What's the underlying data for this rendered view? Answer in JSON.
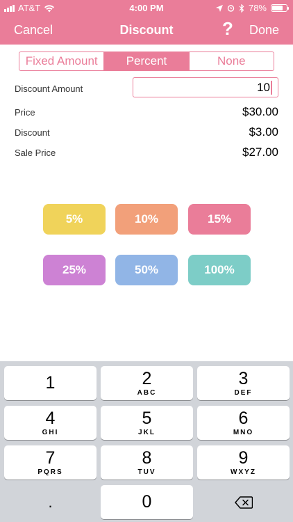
{
  "status": {
    "carrier": "AT&T",
    "time": "4:00 PM",
    "battery": "78%",
    "battery_level": 0.78
  },
  "nav": {
    "cancel_label": "Cancel",
    "title": "Discount",
    "help_label": "?",
    "done_label": "Done"
  },
  "segments": [
    {
      "label": "Fixed Amount",
      "active": false
    },
    {
      "label": "Percent",
      "active": true
    },
    {
      "label": "None",
      "active": false
    }
  ],
  "form": {
    "discount_amount_label": "Discount Amount",
    "discount_amount_value": "10",
    "price_label": "Price",
    "price_value": "$30.00",
    "discount_label": "Discount",
    "discount_value": "$3.00",
    "sale_price_label": "Sale Price",
    "sale_price_value": "$27.00"
  },
  "presets": [
    {
      "label": "5%",
      "color": "#f0d35a"
    },
    {
      "label": "10%",
      "color": "#f2a07a"
    },
    {
      "label": "15%",
      "color": "#ea7d99"
    },
    {
      "label": "25%",
      "color": "#cd82d4"
    },
    {
      "label": "50%",
      "color": "#91b5e6"
    },
    {
      "label": "100%",
      "color": "#7dcdc7"
    }
  ],
  "keys": [
    {
      "num": "1",
      "letters": ""
    },
    {
      "num": "2",
      "letters": "ABC"
    },
    {
      "num": "3",
      "letters": "DEF"
    },
    {
      "num": "4",
      "letters": "GHI"
    },
    {
      "num": "5",
      "letters": "JKL"
    },
    {
      "num": "6",
      "letters": "MNO"
    },
    {
      "num": "7",
      "letters": "PQRS"
    },
    {
      "num": "8",
      "letters": "TUV"
    },
    {
      "num": "9",
      "letters": "WXYZ"
    },
    {
      "num": ".",
      "letters": ""
    },
    {
      "num": "0",
      "letters": ""
    },
    {
      "num": "",
      "letters": "",
      "icon": "backspace-icon"
    }
  ],
  "colors": {
    "accent": "#ea7d99",
    "keyboard_bg": "#d1d4d9"
  }
}
